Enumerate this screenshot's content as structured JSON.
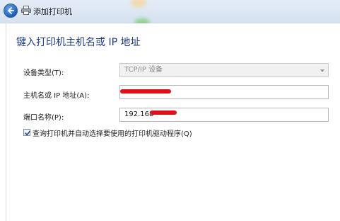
{
  "window": {
    "title": "添加打印机"
  },
  "page": {
    "heading": "键入打印机主机名或 IP 地址"
  },
  "form": {
    "device_type": {
      "label": "设备类型(T):",
      "value": "TCP/IP 设备"
    },
    "hostname": {
      "label": "主机名或 IP 地址(A):",
      "value": ""
    },
    "port_name": {
      "label": "端口名称(P):",
      "value": "192.168"
    },
    "query_printer": {
      "label": "查询打印机并自动选择要使用的打印机驱动程序(Q)",
      "checked": true
    }
  },
  "colors": {
    "heading": "#1e3a8a",
    "redaction": "#e0101a",
    "back_button": "#1d5fb5"
  },
  "icons": {
    "back": "back-arrow-icon",
    "printer": "printer-icon",
    "dropdown": "chevron-down-icon",
    "check": "checkmark-icon"
  }
}
